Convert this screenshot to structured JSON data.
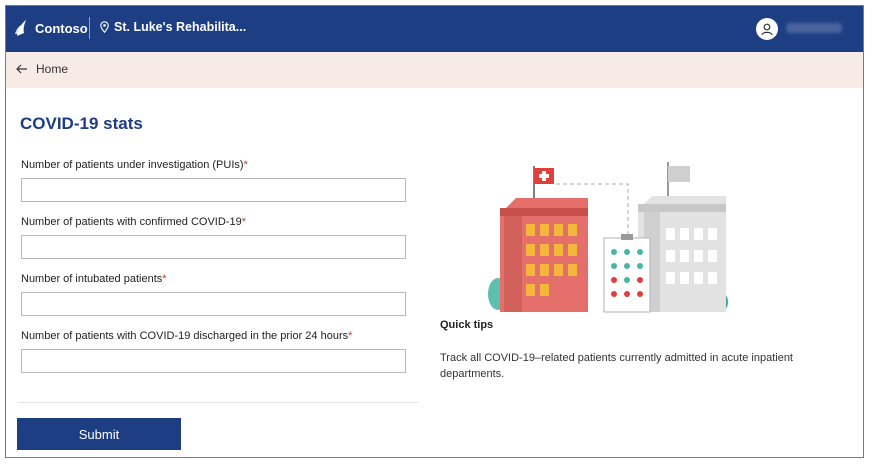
{
  "header": {
    "brand": "Contoso",
    "location": "St. Luke's Rehabilita...",
    "brand_color": "#1d3e83"
  },
  "breadcrumb": {
    "label": "Home"
  },
  "form": {
    "title": "COVID-19 stats",
    "required_mark": "*",
    "fields": [
      {
        "label": "Number of patients under investigation (PUIs)",
        "value": ""
      },
      {
        "label": "Number of patients with confirmed COVID-19",
        "value": ""
      },
      {
        "label": "Number of intubated patients",
        "value": ""
      },
      {
        "label": "Number of patients with COVID-19 discharged in the prior 24 hours",
        "value": ""
      }
    ],
    "submit_label": "Submit"
  },
  "tips": {
    "title": "Quick tips",
    "text": "Track all COVID-19–related patients currently admitted in acute inpatient departments."
  }
}
